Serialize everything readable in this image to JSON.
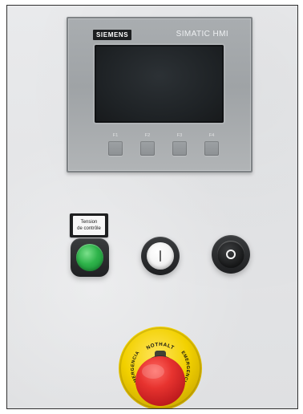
{
  "hmi": {
    "brand": "SIEMENS",
    "model": "SIMATIC HMI",
    "function_keys": [
      {
        "label": "F1"
      },
      {
        "label": "F2"
      },
      {
        "label": "F3"
      },
      {
        "label": "F4"
      }
    ]
  },
  "controls": {
    "tension_label_line1": "Tension",
    "tension_label_line2": "de contrôle",
    "buttons": [
      {
        "name": "green-button"
      },
      {
        "name": "white-button"
      },
      {
        "name": "black-button"
      }
    ]
  },
  "emergency_stop": {
    "top_text": "NOTHALT",
    "left_text": "EMERGENCIA",
    "right_text": "EMERGENCIA"
  },
  "colors": {
    "panel": "#e6e7e9",
    "frame": "#2f2f2f",
    "hmi_bezel": "#a9adb0",
    "green": "#2eb34a",
    "estop_red": "#e7332f",
    "estop_yellow": "#f2d100"
  }
}
